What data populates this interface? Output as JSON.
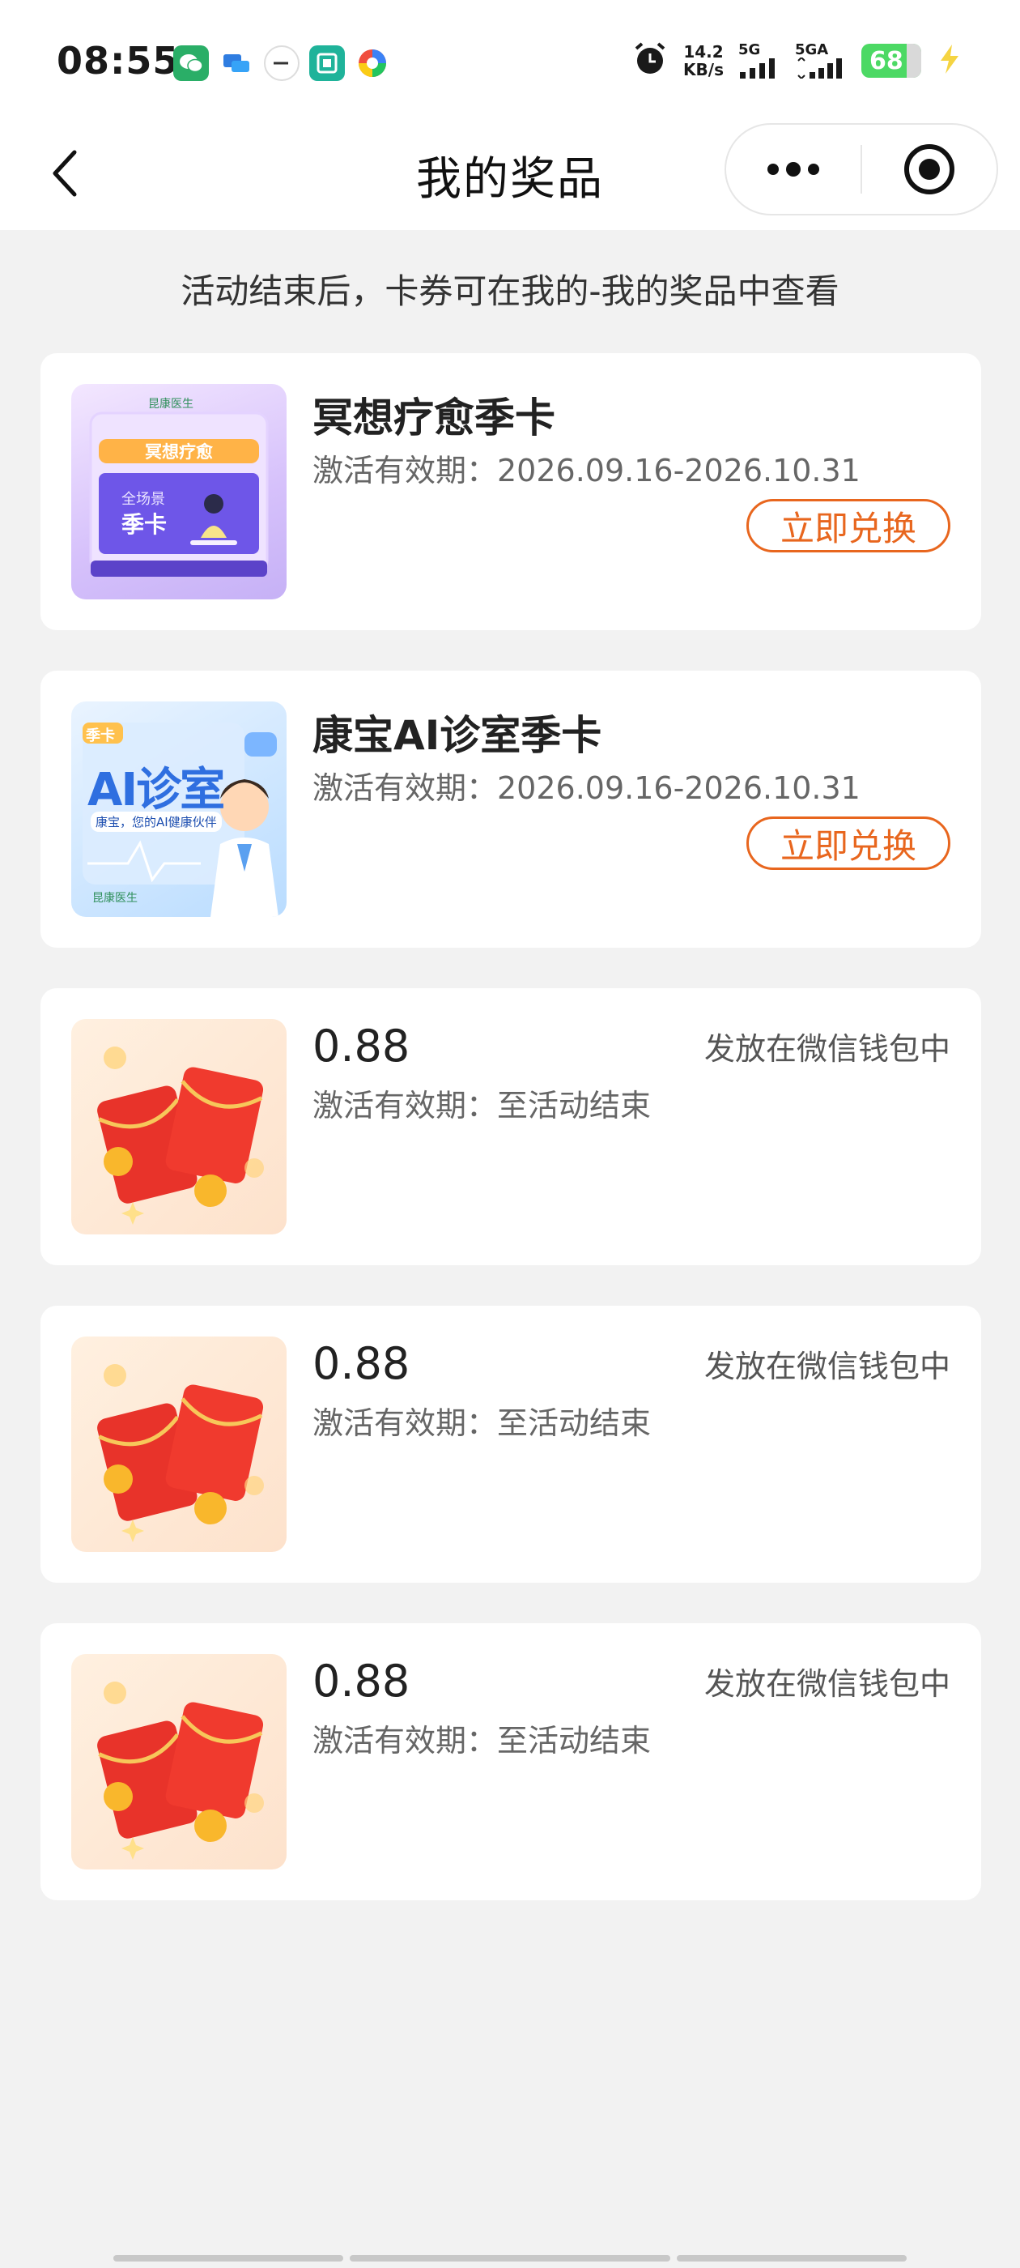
{
  "status_bar": {
    "time": "08:55",
    "net_speed_value": "14.2",
    "net_speed_unit": "KB/s",
    "signal1_label": "5G",
    "signal2_label": "5GA",
    "battery": "68"
  },
  "nav": {
    "title": "我的奖品"
  },
  "hint": "活动结束后，卡券可在我的-我的奖品中查看",
  "thumbnails": {
    "card1_badge": "昆康医生",
    "card1_banner": "冥想疗愈",
    "card1_sub": "全场景",
    "card1_big": "季卡",
    "card2_tag": "季卡",
    "card2_title": "AI诊室",
    "card2_sub": "康宝，您的AI健康伙伴",
    "card2_logo": "昆康医生"
  },
  "cards": [
    {
      "name": "冥想疗愈季卡",
      "validity": "激活有效期：2026.09.16-2026.10.31",
      "action": "立即兑换"
    },
    {
      "name": "康宝AI诊室季卡",
      "validity": "激活有效期：2026.09.16-2026.10.31",
      "action": "立即兑换"
    },
    {
      "amount": "0.88",
      "validity": "激活有效期：至活动结束",
      "note": "发放在微信钱包中"
    },
    {
      "amount": "0.88",
      "validity": "激活有效期：至活动结束",
      "note": "发放在微信钱包中"
    },
    {
      "amount": "0.88",
      "validity": "激活有效期：至活动结束",
      "note": "发放在微信钱包中"
    }
  ],
  "colors": {
    "accent": "#e8661e",
    "background": "#f2f2f2",
    "card": "#ffffff",
    "battery": "#4cd964"
  }
}
